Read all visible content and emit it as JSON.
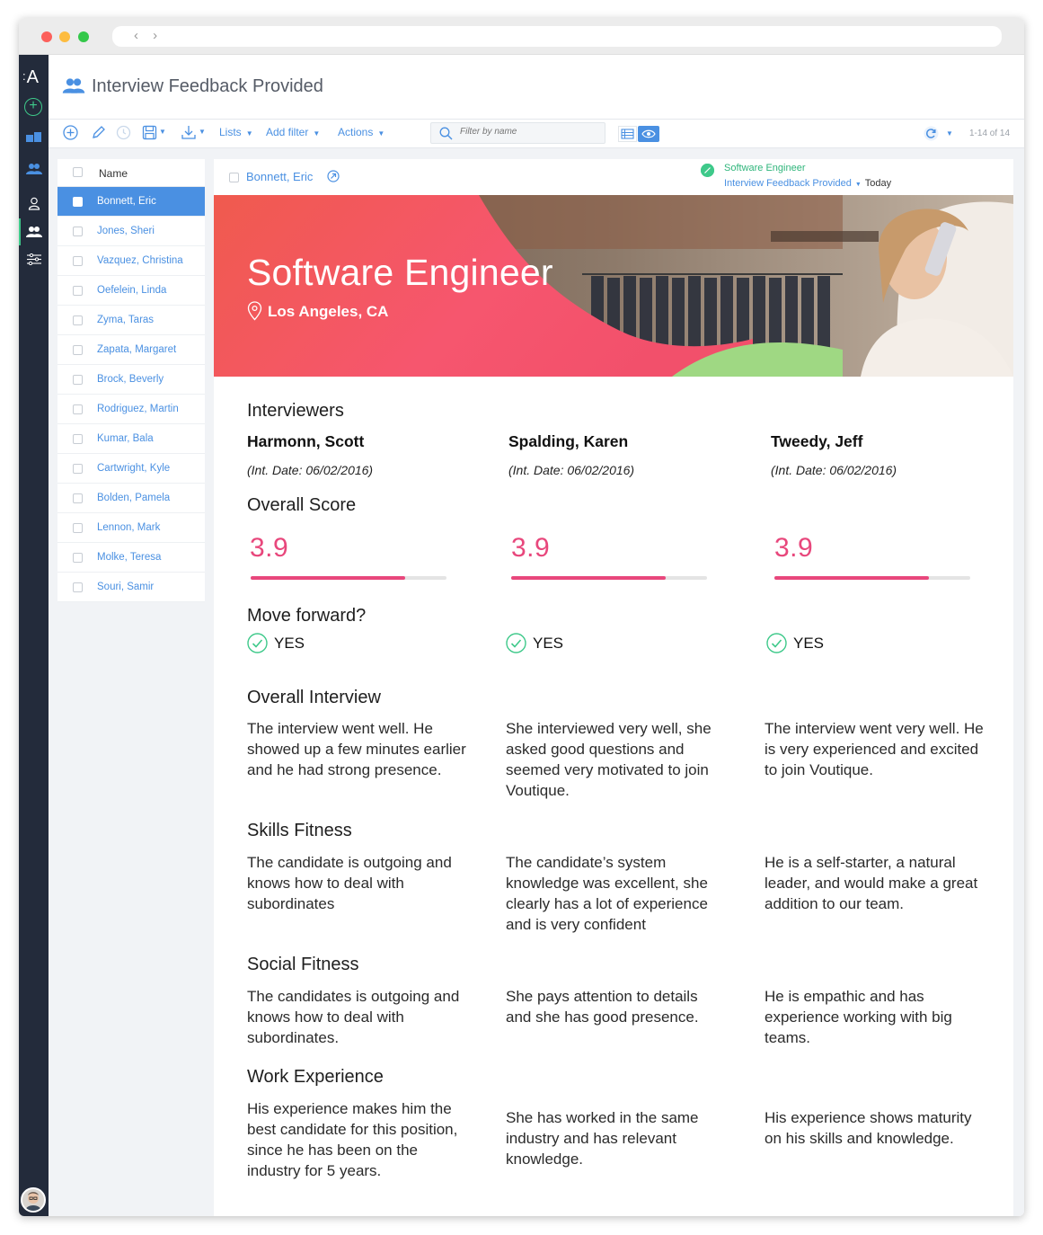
{
  "window": {
    "url": ""
  },
  "rail": {
    "logo": "A"
  },
  "header": {
    "title": "Interview Feedback Provided"
  },
  "toolbar": {
    "lists_label": "Lists",
    "add_filter_label": "Add filter",
    "actions_label": "Actions",
    "filter_placeholder": "Filter by name",
    "count": "1-14 of 14"
  },
  "list": {
    "header": "Name",
    "rows": [
      "Bonnett, Eric",
      "Jones, Sheri",
      "Vazquez, Christina",
      "Oefelein, Linda",
      "Zyma, Taras",
      "Zapata, Margaret",
      "Brock, Beverly",
      "Rodriguez, Martin",
      "Kumar, Bala",
      "Cartwright, Kyle",
      "Bolden, Pamela",
      "Lennon, Mark",
      "Molke, Teresa",
      "Souri, Samir"
    ]
  },
  "detail": {
    "candidate": "Bonnett, Eric",
    "job": "Software Engineer",
    "status": "Interview Feedback Provided",
    "when": "Today",
    "hero": {
      "title": "Software Engineer",
      "location": "Los Angeles, CA"
    },
    "sections": {
      "interviewers": "Interviewers",
      "overall_score": "Overall Score",
      "move_forward": "Move forward?",
      "overall_interview": "Overall Interview",
      "skills_fitness": "Skills Fitness",
      "social_fitness": "Social Fitness",
      "work_experience": "Work Experience"
    },
    "interviewers": [
      {
        "name": "Harmonn, Scott",
        "date": "(Int. Date: 06/02/2016)",
        "score": "3.9",
        "score_fraction": 0.79,
        "move_forward": "YES",
        "overall": "The interview went well. He showed up a few minutes earlier and he had strong presence.",
        "skills": "The candidate is outgoing and knows how to deal with subordinates",
        "social": "The candidates is outgoing and knows how to deal with subordinates.",
        "work": "His experience makes him the best candidate for this position, since he has been on the industry for 5 years."
      },
      {
        "name": "Spalding, Karen",
        "date": "(Int. Date: 06/02/2016)",
        "score": "3.9",
        "score_fraction": 0.79,
        "move_forward": "YES",
        "overall": "She interviewed very well, she asked good questions and seemed very motivated to join Voutique.",
        "skills": "The candidate’s system knowledge was excellent, she clearly has a lot of experience and is very confident",
        "social": "She pays attention to details and she has good presence.",
        "work": "She has worked in the same industry and has relevant knowledge."
      },
      {
        "name": "Tweedy, Jeff",
        "date": "(Int. Date: 06/02/2016)",
        "score": "3.9",
        "score_fraction": 0.79,
        "move_forward": "YES",
        "overall": "The interview went very well. He is very experienced and excited to join Voutique.",
        "skills": "He is a self-starter, a natural leader, and would make a great addition to our team.",
        "social": "He is empathic and has experience working with big teams.",
        "work": "His experience shows maturity on his skills and knowledge."
      }
    ]
  },
  "colors": {
    "accent": "#4a90e2",
    "score": "#e8477c",
    "success": "#3ec98a",
    "rail": "#232b3b"
  }
}
